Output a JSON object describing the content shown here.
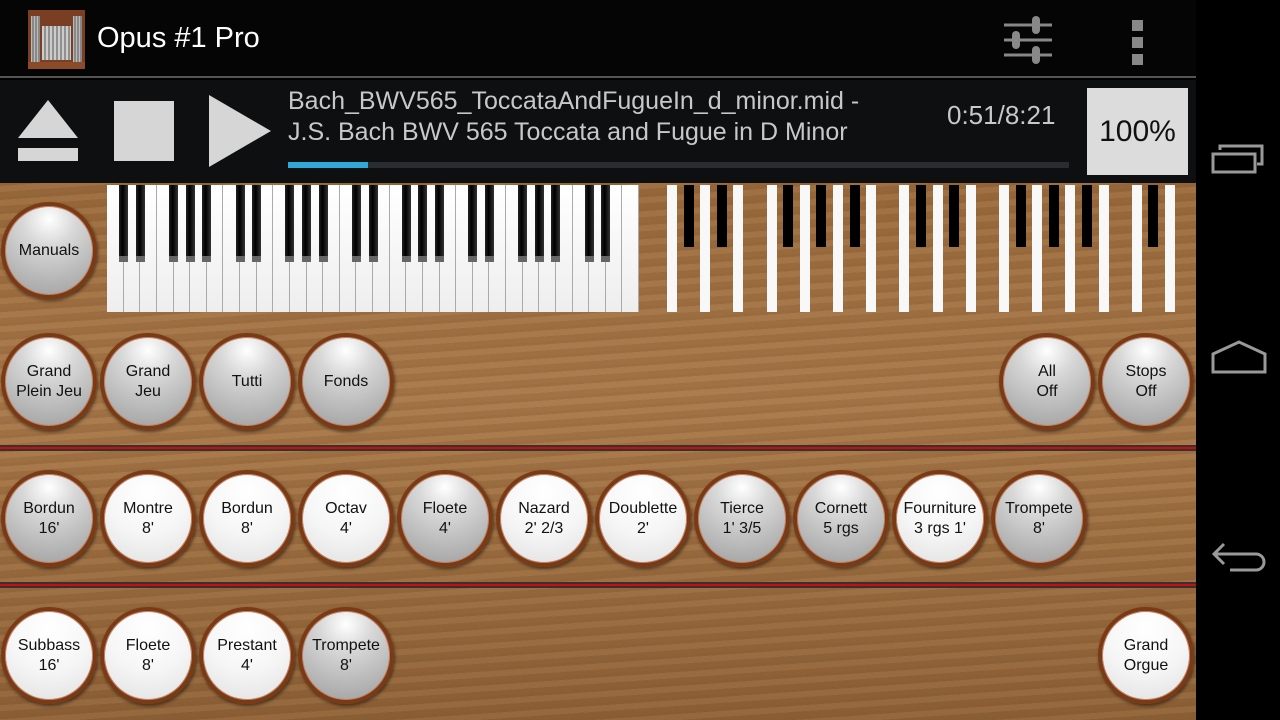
{
  "app": {
    "title": "Opus #1 Pro",
    "logo": "organ-pipes-logo"
  },
  "actionbar": {
    "icons": [
      "mixer-sliders-icon",
      "overflow-menu-icon"
    ]
  },
  "transport": {
    "line1": "Bach_BWV565_ToccataAndFugueIn_d_minor.mid -",
    "line2": "J.S. Bach BWV 565 Toccata and Fugue in D Minor",
    "time": "0:51/8:21",
    "progress": 0.102,
    "zoom": "100%",
    "progress_color": "#2fa8d8"
  },
  "row1": [
    {
      "l1": "Manuals",
      "l2": "",
      "on": false
    }
  ],
  "row2_left": [
    {
      "l1": "Grand",
      "l2": "Plein Jeu",
      "on": false
    },
    {
      "l1": "Grand",
      "l2": "Jeu",
      "on": false
    },
    {
      "l1": "Tutti",
      "l2": "",
      "on": false
    },
    {
      "l1": "Fonds",
      "l2": "",
      "on": false
    }
  ],
  "row2_right": [
    {
      "l1": "All",
      "l2": "Off",
      "on": false
    },
    {
      "l1": "Stops",
      "l2": "Off",
      "on": false
    }
  ],
  "row3": [
    {
      "l1": "Bordun",
      "l2": "16'",
      "on": false
    },
    {
      "l1": "Montre",
      "l2": "8'",
      "on": true
    },
    {
      "l1": "Bordun",
      "l2": "8'",
      "on": true
    },
    {
      "l1": "Octav",
      "l2": "4'",
      "on": true
    },
    {
      "l1": "Floete",
      "l2": "4'",
      "on": false
    },
    {
      "l1": "Nazard",
      "l2": "2' 2/3",
      "on": true
    },
    {
      "l1": "Doublette",
      "l2": "2'",
      "on": true
    },
    {
      "l1": "Tierce",
      "l2": "1' 3/5",
      "on": false
    },
    {
      "l1": "Cornett",
      "l2": "5 rgs",
      "on": false
    },
    {
      "l1": "Fourniture",
      "l2": "3 rgs 1'",
      "on": true
    },
    {
      "l1": "Trompete",
      "l2": "8'",
      "on": false
    }
  ],
  "row4": [
    {
      "l1": "Subbass",
      "l2": "16'",
      "on": true
    },
    {
      "l1": "Floete",
      "l2": "8'",
      "on": true
    },
    {
      "l1": "Prestant",
      "l2": "4'",
      "on": true
    },
    {
      "l1": "Trompete",
      "l2": "8'",
      "on": false
    }
  ],
  "row4_right": [
    {
      "l1": "Grand",
      "l2": "Orgue",
      "on": true
    }
  ],
  "navbar": {
    "icons": [
      "recent-apps-icon",
      "home-icon",
      "back-icon"
    ]
  }
}
